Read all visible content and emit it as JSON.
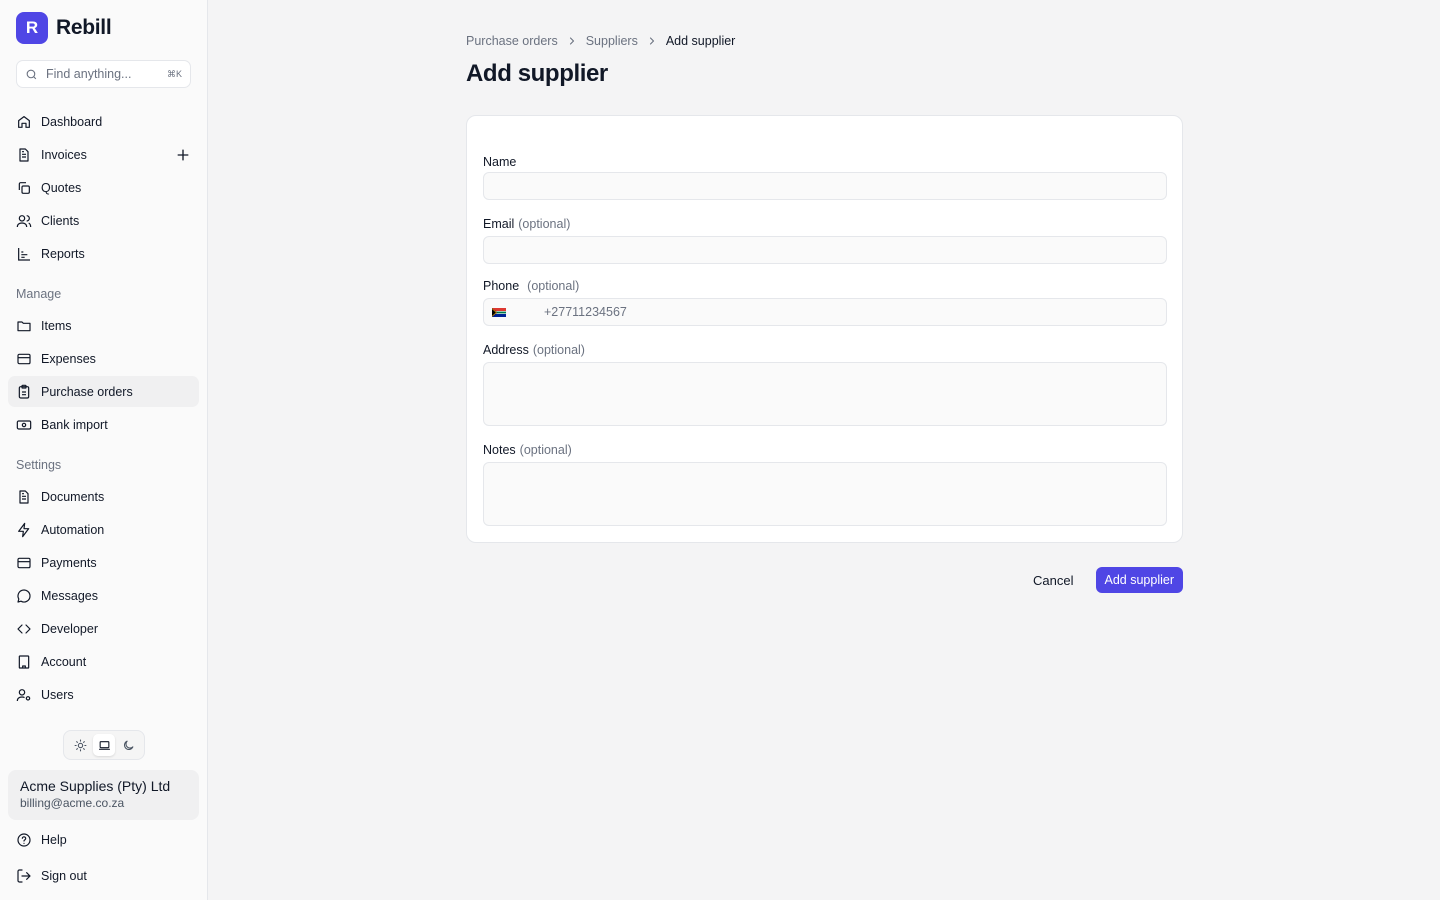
{
  "brand": {
    "logo_letter": "R",
    "name": "Rebill"
  },
  "search": {
    "placeholder": "Find anything...",
    "shortcut": "⌘K"
  },
  "nav": {
    "primary": [
      {
        "label": "Dashboard",
        "icon": "home-icon"
      },
      {
        "label": "Invoices",
        "icon": "file-text-icon"
      },
      {
        "label": "Quotes",
        "icon": "copy-icon"
      },
      {
        "label": "Clients",
        "icon": "users-icon"
      },
      {
        "label": "Reports",
        "icon": "bar-chart-icon"
      }
    ],
    "manage_label": "Manage",
    "manage": [
      {
        "label": "Items",
        "icon": "folder-icon"
      },
      {
        "label": "Expenses",
        "icon": "credit-card-icon"
      },
      {
        "label": "Purchase orders",
        "icon": "clipboard-icon"
      },
      {
        "label": "Bank import",
        "icon": "banknote-icon"
      }
    ],
    "settings_label": "Settings",
    "settings": [
      {
        "label": "Documents",
        "icon": "file-text-icon"
      },
      {
        "label": "Automation",
        "icon": "zap-icon"
      },
      {
        "label": "Payments",
        "icon": "credit-card-icon"
      },
      {
        "label": "Messages",
        "icon": "message-circle-icon"
      },
      {
        "label": "Developer",
        "icon": "code-icon"
      },
      {
        "label": "Account",
        "icon": "building-icon"
      },
      {
        "label": "Users",
        "icon": "user-cog-icon"
      }
    ],
    "active": "Purchase orders"
  },
  "theme": {
    "options": [
      "light",
      "system",
      "dark"
    ],
    "selected": "system"
  },
  "account": {
    "name": "Acme Supplies (Pty) Ltd",
    "email": "billing@acme.co.za"
  },
  "footer": {
    "help_label": "Help",
    "signout_label": "Sign out"
  },
  "breadcrumb": [
    "Purchase orders",
    "Suppliers",
    "Add supplier"
  ],
  "page": {
    "title": "Add supplier"
  },
  "form": {
    "name": {
      "label": "Name",
      "value": ""
    },
    "email": {
      "label": "Email",
      "optional": "(optional)",
      "value": ""
    },
    "phone": {
      "label": "Phone",
      "optional": "(optional)",
      "placeholder": "+27711234567",
      "value": ""
    },
    "address": {
      "label": "Address",
      "optional": "(optional)",
      "value": ""
    },
    "notes": {
      "label": "Notes",
      "optional": "(optional)",
      "value": ""
    }
  },
  "actions": {
    "cancel": "Cancel",
    "submit": "Add supplier"
  },
  "colors": {
    "accent": "#4f46e5",
    "sidebar_bg": "#fafafa",
    "page_bg": "#f4f4f5"
  }
}
